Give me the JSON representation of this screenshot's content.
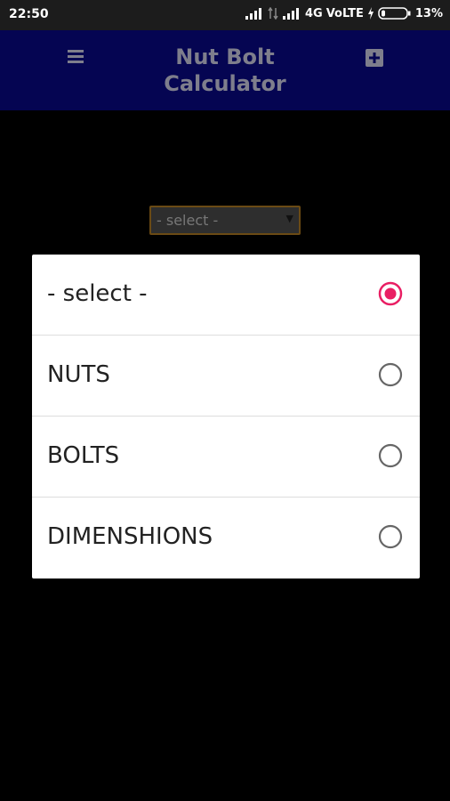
{
  "status_bar": {
    "time": "22:50",
    "network": "4G",
    "volte": "VoLTE",
    "battery": "13%"
  },
  "app_bar": {
    "title": "Nut Bolt Calculator",
    "colors": {
      "background": "#050552"
    }
  },
  "background_spinner": {
    "value": "- select -"
  },
  "dialog": {
    "accent_color": "#e91e63",
    "options": [
      {
        "label": "- select -",
        "selected": true
      },
      {
        "label": "NUTS",
        "selected": false
      },
      {
        "label": "BOLTS",
        "selected": false
      },
      {
        "label": "DIMENSHIONS",
        "selected": false
      }
    ]
  },
  "icons": {
    "menu": "hamburger-menu-icon",
    "add": "add-box-icon"
  }
}
